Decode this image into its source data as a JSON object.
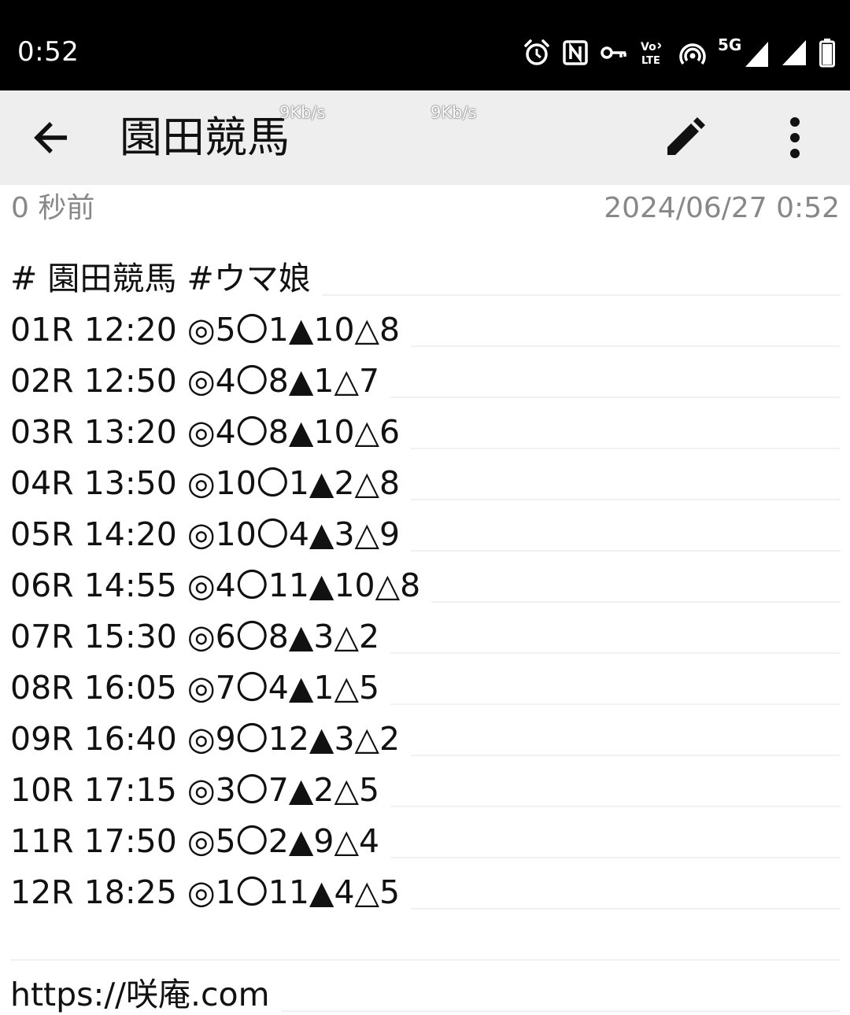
{
  "status_bar": {
    "time": "0:52",
    "icons": [
      "alarm-icon",
      "nfc-icon",
      "vpn-key-icon",
      "volte-icon",
      "hotspot-icon",
      "signal-5g-icon",
      "signal-icon",
      "battery-icon"
    ],
    "network_type": "5G"
  },
  "toolbar": {
    "title": "園田競馬",
    "back_icon": "arrow-back-icon",
    "edit_icon": "pencil-icon",
    "more_icon": "more-vert-icon",
    "net_speed_1": "9Kb/s",
    "net_speed_2": "9Kb/s"
  },
  "meta": {
    "relative_time": "0 秒前",
    "datetime": "2024/06/27 0:52"
  },
  "note": {
    "lines": [
      "# 園田競馬 #ウマ娘",
      "01R 12:20 ◎5〇1▲10△8",
      "02R 12:50 ◎4〇8▲1△7",
      "03R 13:20 ◎4〇8▲10△6",
      "04R 13:50 ◎10〇1▲2△8",
      "05R 14:20 ◎10〇4▲3△9",
      "06R 14:55 ◎4〇11▲10△8",
      "07R 15:30 ◎6〇8▲3△2",
      "08R 16:05 ◎7〇4▲1△5",
      "09R 16:40 ◎9〇12▲3△2",
      "10R 17:15 ◎3〇7▲2△5",
      "11R 17:50 ◎5〇2▲9△4",
      "12R 18:25 ◎1〇11▲4△5",
      "",
      "https://咲庵.com"
    ]
  },
  "colors": {
    "status_bar_bg": "#000000",
    "toolbar_bg": "#eeeeee",
    "meta_text": "#888888",
    "body_text": "#111111",
    "rule_line": "#f1f1f1"
  }
}
